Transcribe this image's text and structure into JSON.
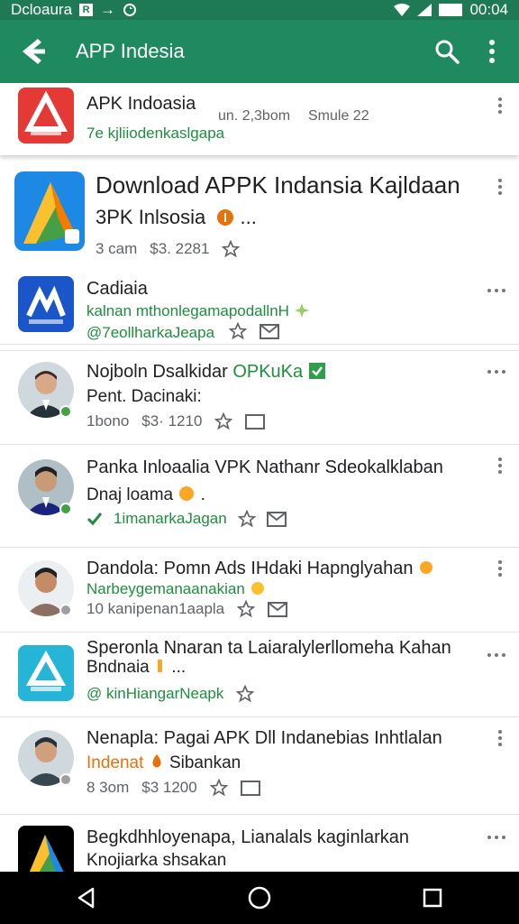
{
  "status_bar": {
    "left_text": "Dcloaura",
    "box_glyph": "R",
    "arrow": "→",
    "right_battery": "100%",
    "time": "00:04"
  },
  "app_bar": {
    "title": "APP Indesia"
  },
  "colors": {
    "app_bar": "#1f8a5f",
    "status_bar": "#1e7a55",
    "green_text": "#1e8e3e",
    "accent_orange": "#e8710a"
  },
  "top_card": {
    "title": "APK Indoasia",
    "green": "7e kjliiodenkaslgapa",
    "meta_left": "un. 2,3bom",
    "meta_right": "Smule 22"
  },
  "items": [
    {
      "title": "Download APPK Indansia Kajldaan",
      "sub": "3PK Inlsosia",
      "sub_suffix": "...",
      "meta": "3 cam",
      "price": "$3. 2281",
      "icon": "apk-logo-icon"
    },
    {
      "title": "Cadiaia",
      "green": "kalnan mthonlegamapodallnH",
      "green2": "@7eollharkaJeapa",
      "icon": "app-logo-blue-icon"
    },
    {
      "title": "Nojboln Dsalkidar",
      "title_green": "OPKuKa",
      "sub": "Pent. Dacinaki:",
      "meta": "1bono",
      "price": "$3· 1210",
      "icon": "avatar-man-1"
    },
    {
      "title": "Panka Inloaalia VPK Nathanr Sdeokalklaban",
      "sub": "Dnaj loama",
      "green": "1imanarkaJagan",
      "icon": "avatar-man-2"
    },
    {
      "title": "Dandola: Pomn Ads IHdaki Hapnglyahan",
      "green": "Narbeygemanaanakian",
      "meta_text": "10 kanipenan1aapla",
      "icon": "avatar-man-3"
    },
    {
      "title": "Speronla Nnaran ta Laiaralylerllomeha Kahan",
      "title2": "Bndnaia",
      "green": "@ kinHiangarNeapk",
      "icon": "app-logo-cyan-icon"
    },
    {
      "title": "Nenapla: Pagai APK Dll Indanebias Inhtlalan",
      "orange": "Indenat",
      "sub_after": "Sibankan",
      "meta": "8 3om",
      "price": "$3 1200",
      "icon": "avatar-man-4"
    },
    {
      "title": "Begkdhhloyenapa, Lianalals kaginlarkan",
      "sub": "Knojiarka shsakan",
      "icon": "apk-logo-dark-icon"
    }
  ]
}
